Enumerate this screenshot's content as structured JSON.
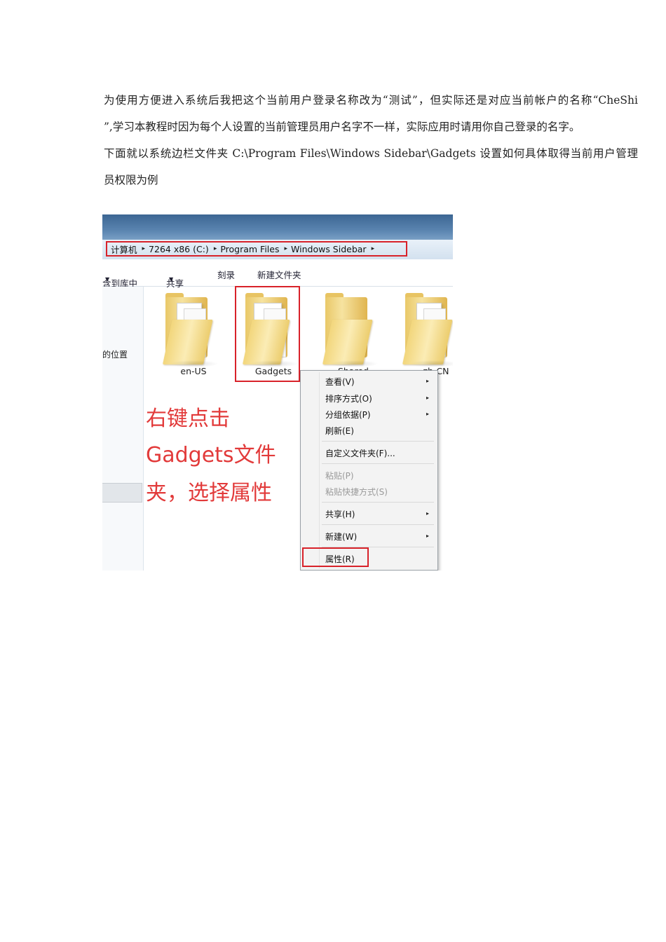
{
  "document": {
    "paragraphs": [
      "为使用方便进入系统后我把这个当前用户登录名称改为“测试”，但实际还是对应当前帐户的名称“CheShi",
      "”,学习本教程时因为每个人设置的当前管理员用户名字不一样，实际应用时请用你自己登录的名字。",
      "下面就以系统边栏文件夹 C:\\Program Files\\Windows Sidebar\\Gadgets 设置如何具体取得当前用户管理",
      "员权限为例"
    ]
  },
  "screenshot": {
    "address_bar": {
      "segments": [
        "计算机",
        "7264 x86 (C:)",
        "Program Files",
        "Windows Sidebar"
      ],
      "arrow": "▸"
    },
    "toolbar": {
      "include_library": "含到库中",
      "share": "共享",
      "burn": "刻录",
      "new_folder": "新建文件夹",
      "dropdown": "▼"
    },
    "left_pane": {
      "location_label": "的位置"
    },
    "folders": [
      "en-US",
      "Gadgets",
      "Shared",
      "zh-CN"
    ],
    "annotation_lines": [
      "右键点击",
      "Gadgets文件",
      "夹，选择属性"
    ],
    "context_menu": {
      "items": [
        {
          "label": "查看(V)",
          "submenu": true,
          "disabled": false
        },
        {
          "label": "排序方式(O)",
          "submenu": true,
          "disabled": false
        },
        {
          "label": "分组依据(P)",
          "submenu": true,
          "disabled": false
        },
        {
          "label": "刷新(E)",
          "submenu": false,
          "disabled": false
        },
        {
          "label": "自定义文件夹(F)...",
          "submenu": false,
          "disabled": false
        },
        {
          "label": "粘贴(P)",
          "submenu": false,
          "disabled": true
        },
        {
          "label": "粘贴快捷方式(S)",
          "submenu": false,
          "disabled": true
        },
        {
          "label": "共享(H)",
          "submenu": true,
          "disabled": false
        },
        {
          "label": "新建(W)",
          "submenu": true,
          "disabled": false
        },
        {
          "label": "属性(R)",
          "submenu": false,
          "disabled": false
        }
      ],
      "submenu_arrow": "▸"
    },
    "colors": {
      "highlight_red": "#d8222a",
      "annotation_red": "#e23a3a",
      "title_blue": "#4a74a2"
    }
  }
}
